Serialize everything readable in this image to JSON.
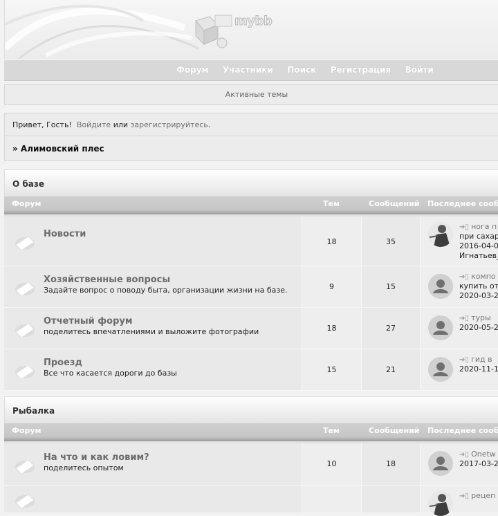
{
  "header": {
    "logo": "mybb"
  },
  "nav": [
    "Форум",
    "Участники",
    "Поиск",
    "Регистрация",
    "Войти"
  ],
  "active_topics": "Активные темы",
  "greeting": {
    "hello": "Привет, Гость!",
    "login": "Войдите",
    "or": "или",
    "register": "зарегистрируйтесь",
    "dot": "."
  },
  "breadcrumb": "» Алимовский плес",
  "columns": {
    "forum": "Форум",
    "topics": "Тем",
    "posts": "Сообщений",
    "last": "Последнее сооб"
  },
  "categories": [
    {
      "name": "О базе",
      "forums": [
        {
          "title": "Новости",
          "desc": "",
          "topics": "18",
          "posts": "35",
          "last_lines": [
            "нога п",
            "при сахар",
            "2016-04-0",
            "Игнатьев_"
          ],
          "avatar": "custom"
        },
        {
          "title": "Хозяйственные вопросы",
          "desc": "Задайте вопрос о поводу быта, организации жизни на базе.",
          "topics": "9",
          "posts": "15",
          "last_lines": [
            "компо",
            "купить от",
            "2020-03-2"
          ],
          "avatar": "default"
        },
        {
          "title": "Отчетный форум",
          "desc": "поделитесь впечатлениями и выложите фотографии",
          "topics": "18",
          "posts": "27",
          "last_lines": [
            "туры",
            "2020-05-2"
          ],
          "avatar": "default"
        },
        {
          "title": "Проезд",
          "desc": "Все что касается дороги до базы",
          "topics": "15",
          "posts": "21",
          "last_lines": [
            "гид в",
            "2020-11-1"
          ],
          "avatar": "default"
        }
      ]
    },
    {
      "name": "Рыбалка",
      "forums": [
        {
          "title": "На что и как ловим?",
          "desc": "поделитесь опытом",
          "topics": "10",
          "posts": "18",
          "last_lines": [
            "Onetw",
            "2017-03-2"
          ],
          "avatar": "default"
        },
        {
          "title": "",
          "desc": "",
          "topics": "",
          "posts": "",
          "last_lines": [
            "рецеп"
          ],
          "avatar": "custom"
        }
      ]
    }
  ]
}
